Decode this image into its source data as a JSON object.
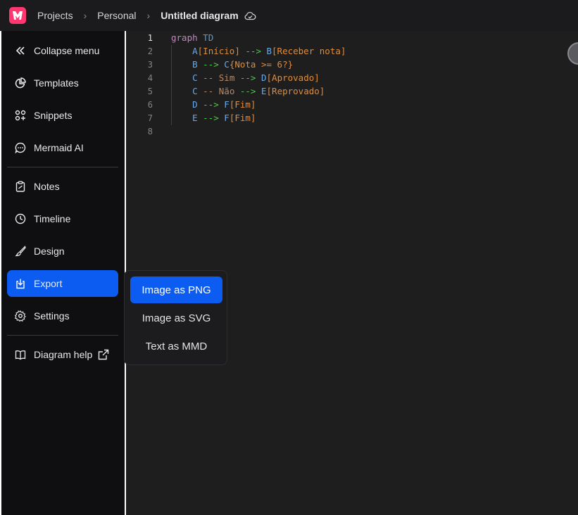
{
  "header": {
    "breadcrumb": [
      "Projects",
      "Personal"
    ],
    "separator": "›",
    "title": "Untitled diagram"
  },
  "sidebar": {
    "items": [
      {
        "label": "Collapse menu",
        "icon": "collapse-chevrons-icon"
      },
      {
        "label": "Templates",
        "icon": "pie-chart-icon"
      },
      {
        "label": "Snippets",
        "icon": "grid-plus-icon"
      },
      {
        "label": "Mermaid AI",
        "icon": "chat-bubble-icon"
      },
      {
        "label": "Notes",
        "icon": "clipboard-icon"
      },
      {
        "label": "Timeline",
        "icon": "clock-icon"
      },
      {
        "label": "Design",
        "icon": "brush-icon"
      },
      {
        "label": "Export",
        "icon": "export-icon"
      },
      {
        "label": "Settings",
        "icon": "gear-icon"
      },
      {
        "label": "Diagram help",
        "icon": "book-icon"
      }
    ]
  },
  "editor": {
    "line_numbers": [
      "1",
      "2",
      "3",
      "4",
      "5",
      "6",
      "7",
      "8"
    ],
    "lines": [
      {
        "k1": "graph",
        "k2": "TD"
      },
      {
        "a": "A",
        "b1": "[Início]",
        "arr": "-->",
        "c": "B",
        "b2": "[Receber nota]"
      },
      {
        "a": "B",
        "arr": "-->",
        "c": "C",
        "b2": "{Nota >= 6?}"
      },
      {
        "a": "C",
        "e1": "--",
        "e2": "Sim",
        "arr": "-->",
        "c": "D",
        "b2": "[Aprovado]"
      },
      {
        "a": "C",
        "e1": "--",
        "e2": "Não",
        "arr": "-->",
        "c": "E",
        "b2": "[Reprovado]"
      },
      {
        "a": "D",
        "arr": "-->",
        "c": "F",
        "b2": "[Fim]"
      },
      {
        "a": "E",
        "arr": "-->",
        "c": "F",
        "b2": "[Fim]"
      }
    ]
  },
  "export_menu": {
    "items": [
      "Image as PNG",
      "Image as SVG",
      "Text as MMD"
    ]
  },
  "colors": {
    "accent": "#0d5cf2",
    "logo": "#ff3670"
  }
}
